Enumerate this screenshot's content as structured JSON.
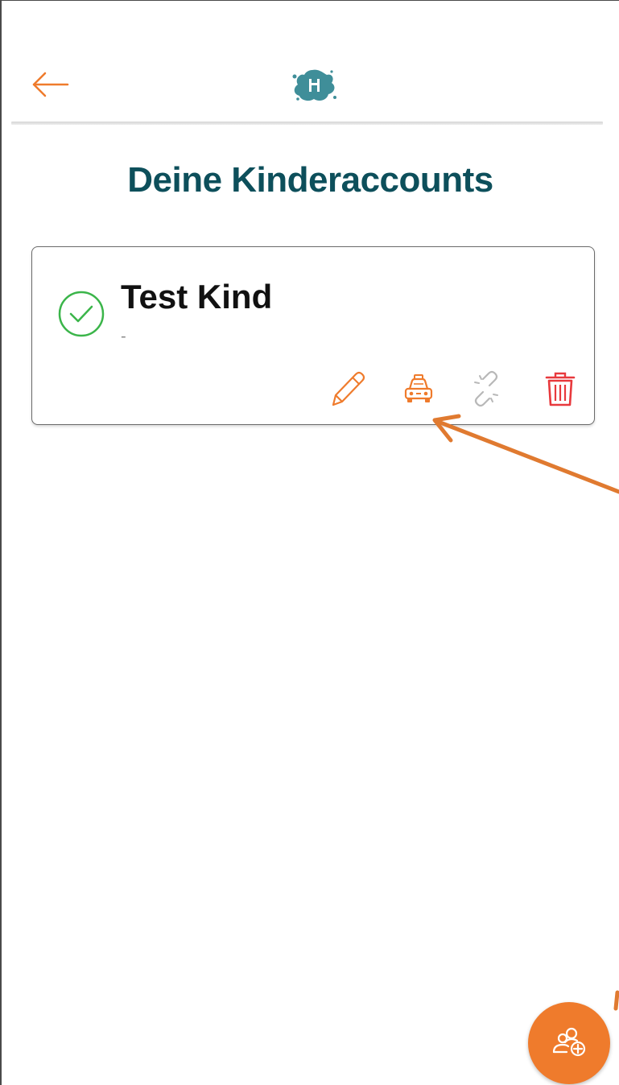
{
  "header": {
    "back_icon": "arrow-left-icon",
    "logo_icon": "app-logo-splash"
  },
  "page": {
    "title": "Deine Kinderaccounts"
  },
  "children": [
    {
      "name": "Test Kind",
      "subtitle": "-",
      "status_icon": "check-circle-icon",
      "actions": [
        {
          "icon": "pencil-icon",
          "label": "edit"
        },
        {
          "icon": "taxi-icon",
          "label": "ride"
        },
        {
          "icon": "unlink-icon",
          "label": "unlink"
        },
        {
          "icon": "trash-icon",
          "label": "delete"
        }
      ]
    }
  ],
  "fab": {
    "icon": "add-users-icon"
  },
  "colors": {
    "accent": "#ef7b2c",
    "title": "#0d4f5b",
    "success": "#3bb54a",
    "danger": "#e8393d",
    "disabled": "#b8b8b8",
    "logo": "#3f8e99"
  }
}
